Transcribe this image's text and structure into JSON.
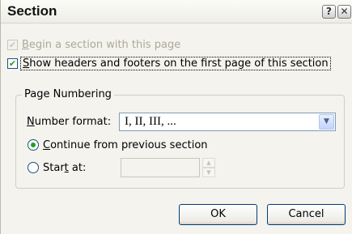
{
  "dialog": {
    "title": "Section",
    "help_glyph": "?",
    "close_glyph": "✕"
  },
  "options": {
    "begin_section": {
      "prefix": "",
      "accel": "B",
      "rest": "egin a section with this page",
      "checked": true,
      "enabled": false
    },
    "show_headers": {
      "accel": "S",
      "rest": "how headers and footers on the first page of this section",
      "checked": true,
      "enabled": true
    }
  },
  "page_numbering": {
    "legend": "Page Numbering",
    "number_format": {
      "label_accel": "N",
      "label_rest": "umber format:",
      "value": "I, II, III, ..."
    },
    "continue": {
      "accel": "C",
      "rest": "ontinue from previous section",
      "selected": true
    },
    "start_at": {
      "prefix": "Star",
      "accel": "t",
      "rest": " at:",
      "selected": false,
      "value": ""
    }
  },
  "buttons": {
    "ok": "OK",
    "cancel": "Cancel"
  },
  "icons": {
    "check": "✔",
    "dropdown": "▼",
    "spin_up": "▲",
    "spin_down": "▼"
  }
}
